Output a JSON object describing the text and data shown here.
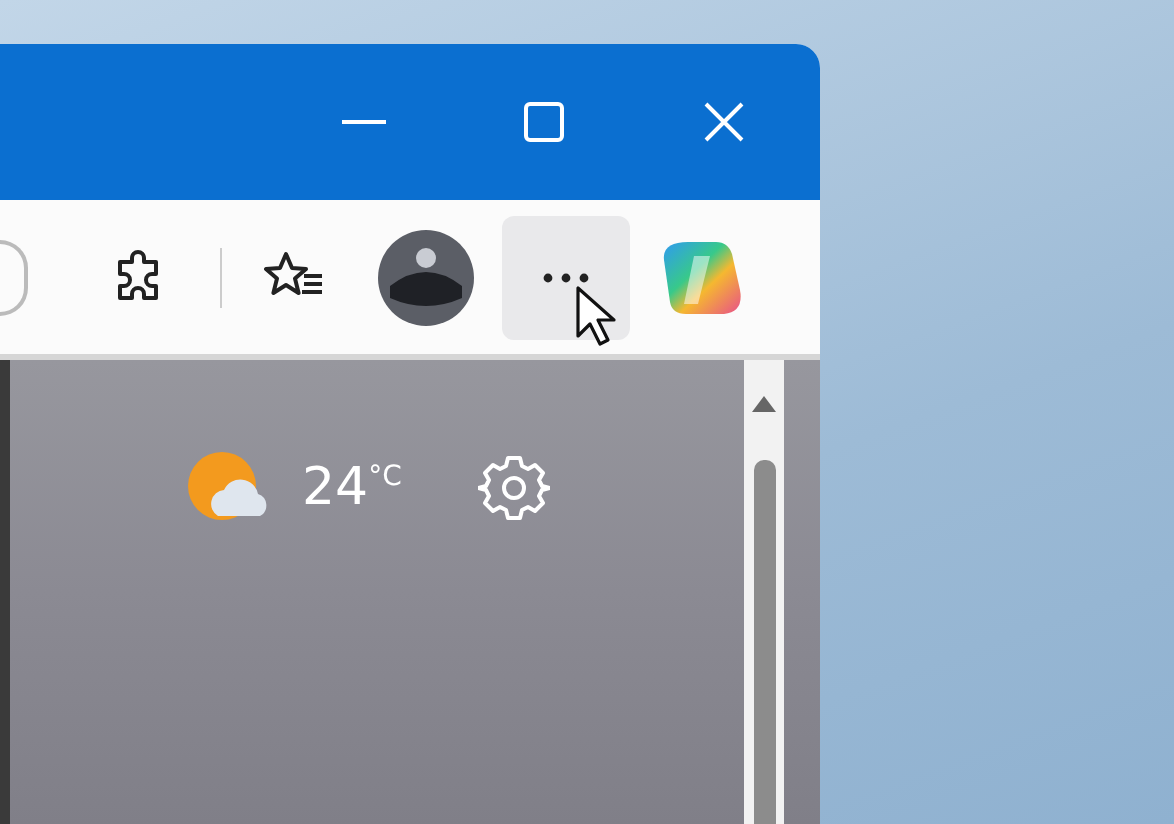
{
  "window": {
    "controls": [
      {
        "kind": "minimize"
      },
      {
        "kind": "maximize"
      },
      {
        "kind": "close"
      }
    ]
  },
  "toolbar": {
    "buttons": [
      {
        "kind": "extensions",
        "highlighted": false
      },
      {
        "kind": "favorites",
        "highlighted": false
      },
      {
        "kind": "profile",
        "highlighted": false
      },
      {
        "kind": "more",
        "highlighted": true
      },
      {
        "kind": "copilot",
        "highlighted": false
      }
    ]
  },
  "weather": {
    "temperature": "24$^{°C}$"
  }
}
